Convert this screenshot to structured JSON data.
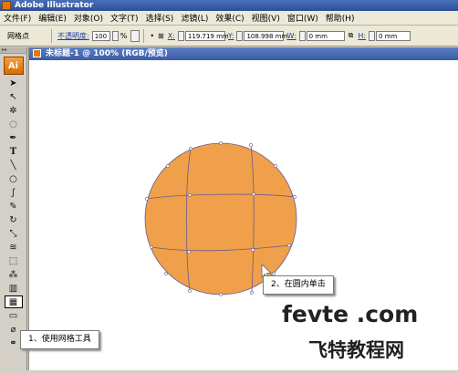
{
  "window": {
    "title": "Adobe Illustrator"
  },
  "menu": [
    "文件(F)",
    "编辑(E)",
    "对象(O)",
    "文字(T)",
    "选择(S)",
    "滤镜(L)",
    "效果(C)",
    "视图(V)",
    "窗口(W)",
    "帮助(H)"
  ],
  "control_bar": {
    "tool_name": "网格点",
    "opacity_label": "不透明度:",
    "opacity_value": "100",
    "opacity_unit": "%",
    "x_label": "X:",
    "x_value": "119.719 mm",
    "y_label": "Y:",
    "y_value": "108.998 mm",
    "w_label": "W:",
    "w_value": "0 mm",
    "h_label": "H:",
    "h_value": "0 mm"
  },
  "toolbox": {
    "logo": "Ai"
  },
  "document": {
    "tab_title": "未标题-1 @ 100% (RGB/预览)"
  },
  "shape": {
    "fill": "#f0a04a",
    "stroke": "#6a5a8a"
  },
  "callouts": {
    "step1": "1、使用网格工具",
    "step2": "2、在圆内单击"
  },
  "watermark": {
    "line1": "fevte .com",
    "line2": "飞特教程网"
  }
}
